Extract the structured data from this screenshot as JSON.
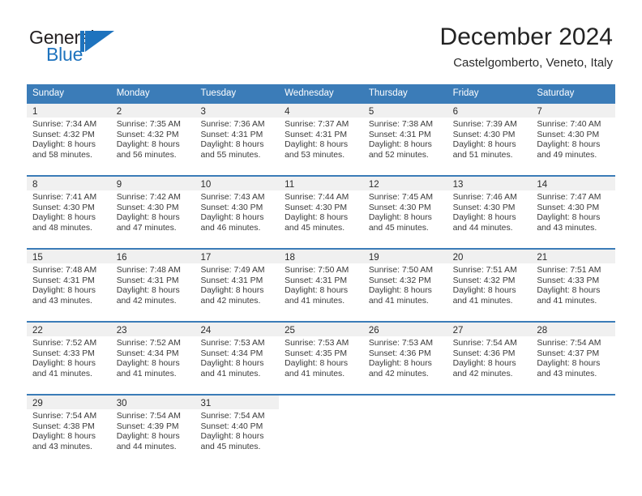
{
  "brand": {
    "name_dark": "General",
    "name_blue": "Blue",
    "accent_color": "#1e73be"
  },
  "header": {
    "title": "December 2024",
    "location": "Castelgomberto, Veneto, Italy"
  },
  "calendar": {
    "header_bg": "#3b7cb8",
    "header_text_color": "#ffffff",
    "daynum_band_color": "#f0f0f0",
    "weekdays": [
      "Sunday",
      "Monday",
      "Tuesday",
      "Wednesday",
      "Thursday",
      "Friday",
      "Saturday"
    ],
    "weeks": [
      [
        {
          "day": "1",
          "sunrise": "Sunrise: 7:34 AM",
          "sunset": "Sunset: 4:32 PM",
          "daylight1": "Daylight: 8 hours",
          "daylight2": "and 58 minutes."
        },
        {
          "day": "2",
          "sunrise": "Sunrise: 7:35 AM",
          "sunset": "Sunset: 4:32 PM",
          "daylight1": "Daylight: 8 hours",
          "daylight2": "and 56 minutes."
        },
        {
          "day": "3",
          "sunrise": "Sunrise: 7:36 AM",
          "sunset": "Sunset: 4:31 PM",
          "daylight1": "Daylight: 8 hours",
          "daylight2": "and 55 minutes."
        },
        {
          "day": "4",
          "sunrise": "Sunrise: 7:37 AM",
          "sunset": "Sunset: 4:31 PM",
          "daylight1": "Daylight: 8 hours",
          "daylight2": "and 53 minutes."
        },
        {
          "day": "5",
          "sunrise": "Sunrise: 7:38 AM",
          "sunset": "Sunset: 4:31 PM",
          "daylight1": "Daylight: 8 hours",
          "daylight2": "and 52 minutes."
        },
        {
          "day": "6",
          "sunrise": "Sunrise: 7:39 AM",
          "sunset": "Sunset: 4:30 PM",
          "daylight1": "Daylight: 8 hours",
          "daylight2": "and 51 minutes."
        },
        {
          "day": "7",
          "sunrise": "Sunrise: 7:40 AM",
          "sunset": "Sunset: 4:30 PM",
          "daylight1": "Daylight: 8 hours",
          "daylight2": "and 49 minutes."
        }
      ],
      [
        {
          "day": "8",
          "sunrise": "Sunrise: 7:41 AM",
          "sunset": "Sunset: 4:30 PM",
          "daylight1": "Daylight: 8 hours",
          "daylight2": "and 48 minutes."
        },
        {
          "day": "9",
          "sunrise": "Sunrise: 7:42 AM",
          "sunset": "Sunset: 4:30 PM",
          "daylight1": "Daylight: 8 hours",
          "daylight2": "and 47 minutes."
        },
        {
          "day": "10",
          "sunrise": "Sunrise: 7:43 AM",
          "sunset": "Sunset: 4:30 PM",
          "daylight1": "Daylight: 8 hours",
          "daylight2": "and 46 minutes."
        },
        {
          "day": "11",
          "sunrise": "Sunrise: 7:44 AM",
          "sunset": "Sunset: 4:30 PM",
          "daylight1": "Daylight: 8 hours",
          "daylight2": "and 45 minutes."
        },
        {
          "day": "12",
          "sunrise": "Sunrise: 7:45 AM",
          "sunset": "Sunset: 4:30 PM",
          "daylight1": "Daylight: 8 hours",
          "daylight2": "and 45 minutes."
        },
        {
          "day": "13",
          "sunrise": "Sunrise: 7:46 AM",
          "sunset": "Sunset: 4:30 PM",
          "daylight1": "Daylight: 8 hours",
          "daylight2": "and 44 minutes."
        },
        {
          "day": "14",
          "sunrise": "Sunrise: 7:47 AM",
          "sunset": "Sunset: 4:30 PM",
          "daylight1": "Daylight: 8 hours",
          "daylight2": "and 43 minutes."
        }
      ],
      [
        {
          "day": "15",
          "sunrise": "Sunrise: 7:48 AM",
          "sunset": "Sunset: 4:31 PM",
          "daylight1": "Daylight: 8 hours",
          "daylight2": "and 43 minutes."
        },
        {
          "day": "16",
          "sunrise": "Sunrise: 7:48 AM",
          "sunset": "Sunset: 4:31 PM",
          "daylight1": "Daylight: 8 hours",
          "daylight2": "and 42 minutes."
        },
        {
          "day": "17",
          "sunrise": "Sunrise: 7:49 AM",
          "sunset": "Sunset: 4:31 PM",
          "daylight1": "Daylight: 8 hours",
          "daylight2": "and 42 minutes."
        },
        {
          "day": "18",
          "sunrise": "Sunrise: 7:50 AM",
          "sunset": "Sunset: 4:31 PM",
          "daylight1": "Daylight: 8 hours",
          "daylight2": "and 41 minutes."
        },
        {
          "day": "19",
          "sunrise": "Sunrise: 7:50 AM",
          "sunset": "Sunset: 4:32 PM",
          "daylight1": "Daylight: 8 hours",
          "daylight2": "and 41 minutes."
        },
        {
          "day": "20",
          "sunrise": "Sunrise: 7:51 AM",
          "sunset": "Sunset: 4:32 PM",
          "daylight1": "Daylight: 8 hours",
          "daylight2": "and 41 minutes."
        },
        {
          "day": "21",
          "sunrise": "Sunrise: 7:51 AM",
          "sunset": "Sunset: 4:33 PM",
          "daylight1": "Daylight: 8 hours",
          "daylight2": "and 41 minutes."
        }
      ],
      [
        {
          "day": "22",
          "sunrise": "Sunrise: 7:52 AM",
          "sunset": "Sunset: 4:33 PM",
          "daylight1": "Daylight: 8 hours",
          "daylight2": "and 41 minutes."
        },
        {
          "day": "23",
          "sunrise": "Sunrise: 7:52 AM",
          "sunset": "Sunset: 4:34 PM",
          "daylight1": "Daylight: 8 hours",
          "daylight2": "and 41 minutes."
        },
        {
          "day": "24",
          "sunrise": "Sunrise: 7:53 AM",
          "sunset": "Sunset: 4:34 PM",
          "daylight1": "Daylight: 8 hours",
          "daylight2": "and 41 minutes."
        },
        {
          "day": "25",
          "sunrise": "Sunrise: 7:53 AM",
          "sunset": "Sunset: 4:35 PM",
          "daylight1": "Daylight: 8 hours",
          "daylight2": "and 41 minutes."
        },
        {
          "day": "26",
          "sunrise": "Sunrise: 7:53 AM",
          "sunset": "Sunset: 4:36 PM",
          "daylight1": "Daylight: 8 hours",
          "daylight2": "and 42 minutes."
        },
        {
          "day": "27",
          "sunrise": "Sunrise: 7:54 AM",
          "sunset": "Sunset: 4:36 PM",
          "daylight1": "Daylight: 8 hours",
          "daylight2": "and 42 minutes."
        },
        {
          "day": "28",
          "sunrise": "Sunrise: 7:54 AM",
          "sunset": "Sunset: 4:37 PM",
          "daylight1": "Daylight: 8 hours",
          "daylight2": "and 43 minutes."
        }
      ],
      [
        {
          "day": "29",
          "sunrise": "Sunrise: 7:54 AM",
          "sunset": "Sunset: 4:38 PM",
          "daylight1": "Daylight: 8 hours",
          "daylight2": "and 43 minutes."
        },
        {
          "day": "30",
          "sunrise": "Sunrise: 7:54 AM",
          "sunset": "Sunset: 4:39 PM",
          "daylight1": "Daylight: 8 hours",
          "daylight2": "and 44 minutes."
        },
        {
          "day": "31",
          "sunrise": "Sunrise: 7:54 AM",
          "sunset": "Sunset: 4:40 PM",
          "daylight1": "Daylight: 8 hours",
          "daylight2": "and 45 minutes."
        },
        {
          "day": "",
          "sunrise": "",
          "sunset": "",
          "daylight1": "",
          "daylight2": ""
        },
        {
          "day": "",
          "sunrise": "",
          "sunset": "",
          "daylight1": "",
          "daylight2": ""
        },
        {
          "day": "",
          "sunrise": "",
          "sunset": "",
          "daylight1": "",
          "daylight2": ""
        },
        {
          "day": "",
          "sunrise": "",
          "sunset": "",
          "daylight1": "",
          "daylight2": ""
        }
      ]
    ]
  }
}
